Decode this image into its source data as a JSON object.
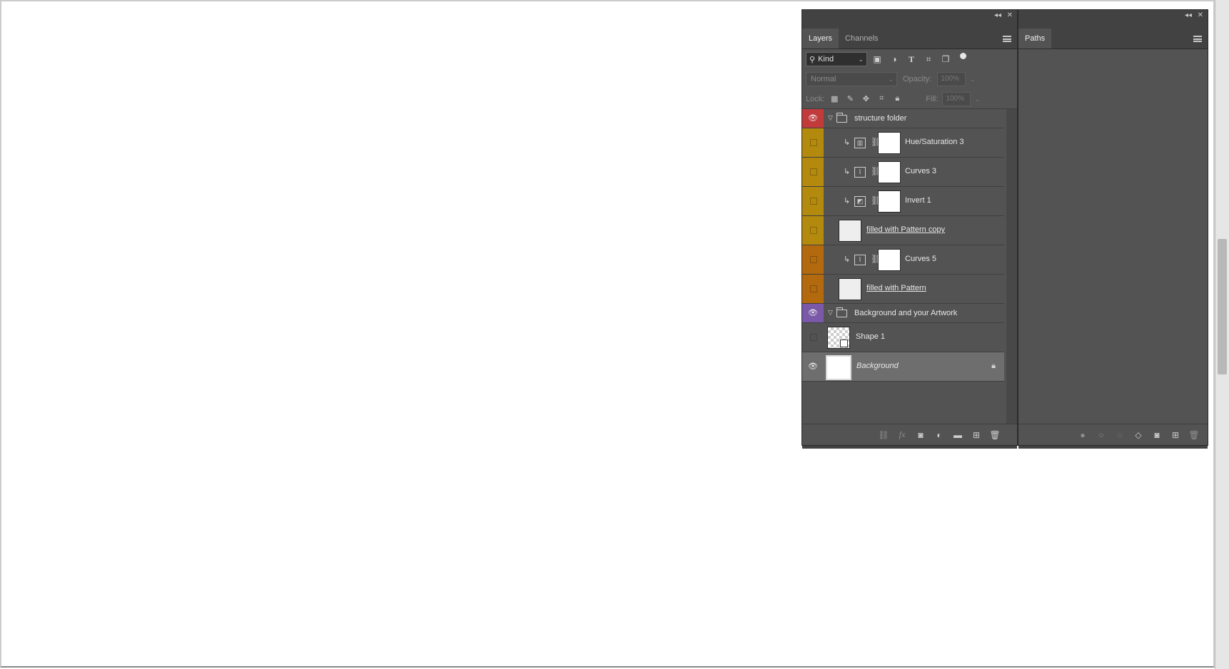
{
  "layers_panel": {
    "tabs": [
      {
        "label": "Layers",
        "active": true
      },
      {
        "label": "Channels",
        "active": false
      }
    ],
    "filter": {
      "kind_label": "Kind"
    },
    "blend_mode": "Normal",
    "opacity_label": "Opacity:",
    "opacity_value": "100%",
    "lock_label": "Lock:",
    "fill_label": "Fill:",
    "fill_value": "100%",
    "layers": [
      {
        "type": "group",
        "name": "structure folder",
        "visible": true,
        "color": "#c23b3b"
      },
      {
        "type": "adjustment",
        "name": "Hue/Saturation 3",
        "visible": false,
        "color": "#b38a0e",
        "icon": "hue-saturation-icon",
        "clipped": true
      },
      {
        "type": "adjustment",
        "name": "Curves 3",
        "visible": false,
        "color": "#b38a0e",
        "icon": "curves-icon",
        "clipped": true
      },
      {
        "type": "adjustment",
        "name": "Invert 1",
        "visible": false,
        "color": "#b38a0e",
        "icon": "invert-icon",
        "clipped": true
      },
      {
        "type": "fill",
        "name": "filled with Pattern copy",
        "visible": false,
        "color": "#b38a0e"
      },
      {
        "type": "adjustment",
        "name": "Curves 5",
        "visible": false,
        "color": "#b36a0e",
        "icon": "curves-icon",
        "clipped": true
      },
      {
        "type": "fill",
        "name": "filled with Pattern",
        "visible": false,
        "color": "#b36a0e"
      },
      {
        "type": "group",
        "name": "Background and your Artwork",
        "visible": true,
        "color": "#7a5aa8"
      },
      {
        "type": "shape",
        "name": "Shape 1",
        "visible": false
      },
      {
        "type": "background",
        "name": "Background",
        "visible": true,
        "locked": true,
        "selected": true
      }
    ]
  },
  "paths_panel": {
    "tabs": [
      {
        "label": "Paths",
        "active": true
      }
    ]
  }
}
